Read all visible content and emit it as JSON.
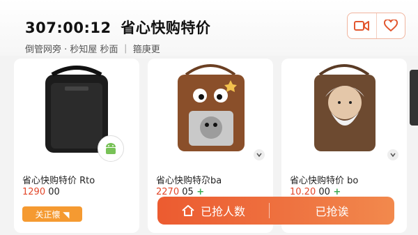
{
  "header": {
    "timer": "307:00:12",
    "title": "省心快购特价",
    "subtitle": "倒管网旁 · 秒知屋 秒面 ｜ 箍庚更",
    "video_icon": "video-camera-icon",
    "favorite_icon": "heart-icon"
  },
  "products": [
    {
      "name": "省心快购特价 Rto",
      "price": "1290",
      "cents": " 00",
      "plus": "",
      "follow_label": "关正懐 ◥",
      "badge": "android-icon"
    },
    {
      "name": "省心快购特尕ba",
      "price": "2270",
      "cents": " 05",
      "plus": " +"
    },
    {
      "name": "省心快购特价 bo",
      "price": "10.20",
      "cents": " 00",
      "plus": " +"
    }
  ],
  "buybar": {
    "left_label": "已抢人数",
    "right_label": "已抢诶",
    "home_icon": "home-icon"
  },
  "colors": {
    "accent": "#ec5b30",
    "price": "#e2472a",
    "follow": "#f59a31"
  }
}
